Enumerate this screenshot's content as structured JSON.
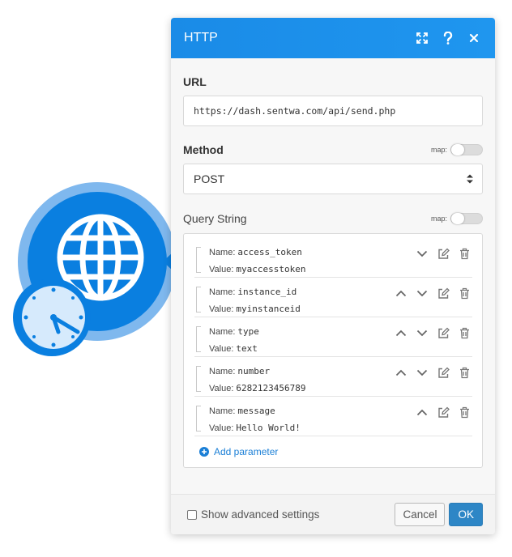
{
  "dialog": {
    "title": "HTTP",
    "url_label": "URL",
    "url_value": "https://dash.sentwa.com/api/send.php",
    "method_label": "Method",
    "method_value": "POST",
    "map_text": "map:",
    "query_label": "Query String",
    "name_key": "Name:",
    "value_key": "Value:",
    "params": [
      {
        "name": "access_token",
        "value": "myaccesstoken"
      },
      {
        "name": "instance_id",
        "value": "myinstanceid"
      },
      {
        "name": "type",
        "value": "text"
      },
      {
        "name": "number",
        "value": "6282123456789"
      },
      {
        "name": "message",
        "value": "Hello World!"
      }
    ],
    "add_parameter": "Add parameter",
    "advanced_settings": "Show advanced settings",
    "cancel": "Cancel",
    "ok": "OK"
  },
  "colors": {
    "header_blue": "#1a8be7",
    "module_blue": "#0a7fe0",
    "module_ring": "#7fb8ee",
    "link_blue": "#1b7fd6",
    "ok_blue": "#2d86c6"
  },
  "icons": [
    "globe-icon",
    "clock-icon",
    "expand-icon",
    "help-icon",
    "close-icon",
    "chevron-up-icon",
    "chevron-down-icon",
    "edit-icon",
    "trash-icon",
    "plus-circle-icon",
    "select-caret-icon"
  ]
}
